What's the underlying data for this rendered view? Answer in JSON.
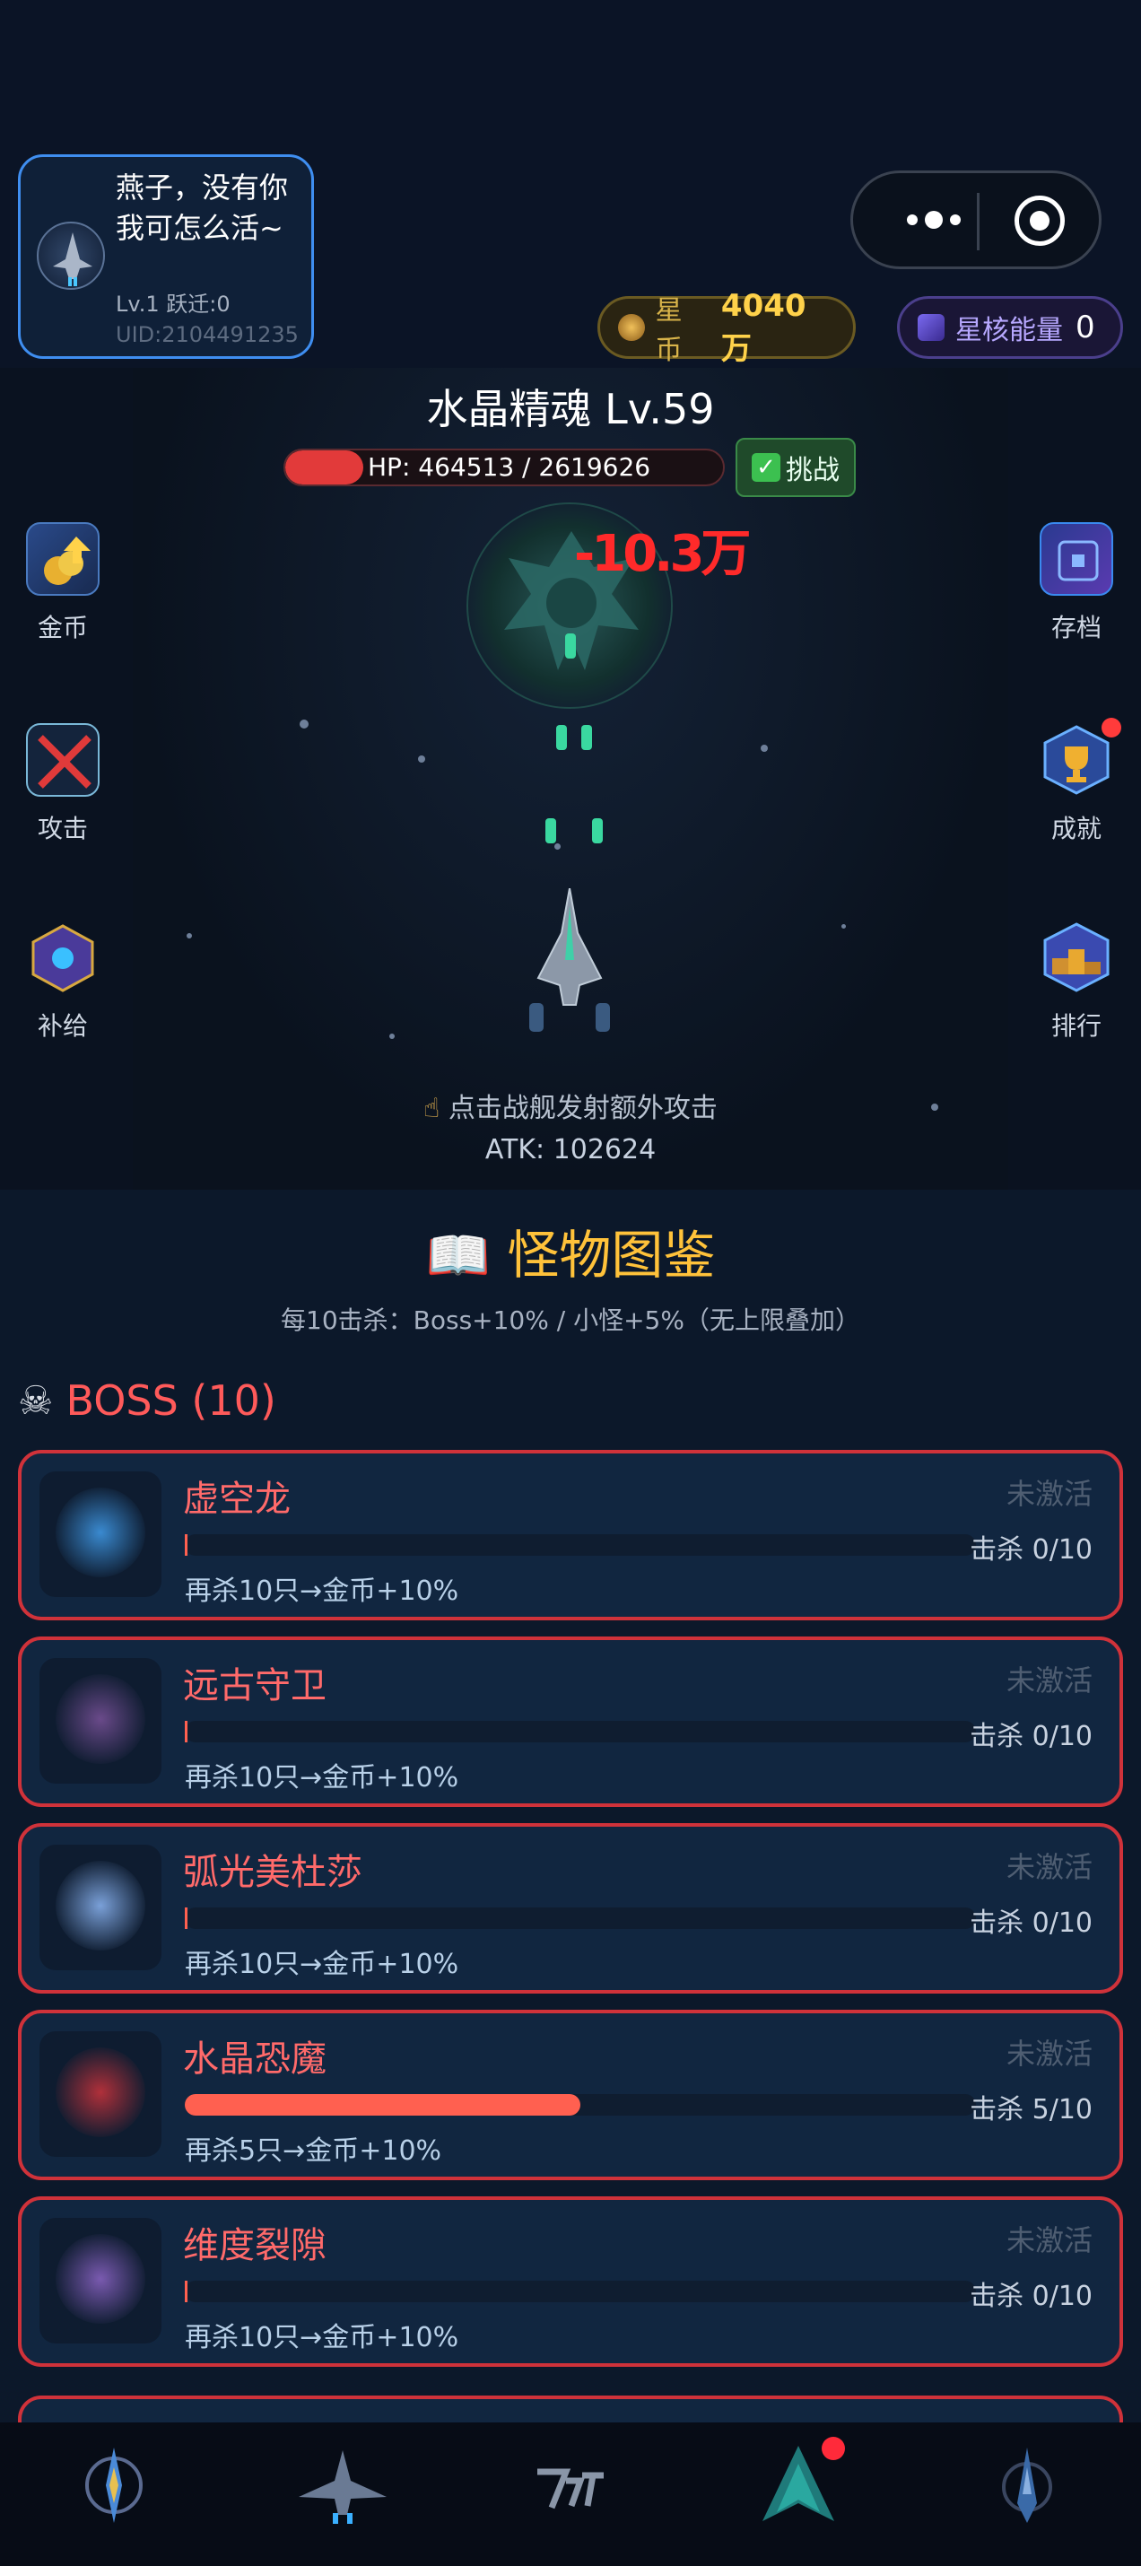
{
  "profile": {
    "nickname": "燕子，没有你我可怎么活~",
    "level_line": "Lv.1 跃迁:0",
    "uid": "UID:2104491235"
  },
  "currency": {
    "coin_label": "星币",
    "coin_value": "4040万",
    "core_label": "星核能量",
    "core_value": "0"
  },
  "battle": {
    "monster_title": "水晶精魂 Lv.59",
    "hp_text": "HP: 464513 / 2619626",
    "hp_current": 464513,
    "hp_max": 2619626,
    "challenge_label": "挑战",
    "damage_text": "-10.3万",
    "tap_hint": "点击战舰发射额外攻击",
    "atk_text": "ATK: 102624"
  },
  "left_menu": [
    {
      "label": "金币",
      "icon": "gold-coins-icon"
    },
    {
      "label": "攻击",
      "icon": "crossed-swords-icon"
    },
    {
      "label": "补给",
      "icon": "supply-crate-icon"
    }
  ],
  "right_menu": [
    {
      "label": "存档",
      "icon": "save-disk-icon",
      "has_badge": false
    },
    {
      "label": "成就",
      "icon": "trophy-icon",
      "has_badge": true
    },
    {
      "label": "排行",
      "icon": "podium-icon",
      "has_badge": false
    }
  ],
  "book": {
    "title": "怪物图鉴",
    "subtitle": "每10击杀：Boss+10% / 小怪+5%（无上限叠加）",
    "section_title": "BOSS (10)"
  },
  "bosses": [
    {
      "name": "虚空龙",
      "state": "未激活",
      "kills": "击杀 0/10",
      "progress": 0.0,
      "bonus": "再杀10只→金币+10%",
      "color": "#3a8ad0"
    },
    {
      "name": "远古守卫",
      "state": "未激活",
      "kills": "击杀 0/10",
      "progress": 0.0,
      "bonus": "再杀10只→金币+10%",
      "color": "#6a4a8a"
    },
    {
      "name": "弧光美杜莎",
      "state": "未激活",
      "kills": "击杀 0/10",
      "progress": 0.0,
      "bonus": "再杀10只→金币+10%",
      "color": "#7aa0d8"
    },
    {
      "name": "水晶恐魔",
      "state": "未激活",
      "kills": "击杀 5/10",
      "progress": 0.5,
      "bonus": "再杀5只→金币+10%",
      "color": "#b0303a"
    },
    {
      "name": "维度裂隙",
      "state": "未激活",
      "kills": "击杀 0/10",
      "progress": 0.0,
      "bonus": "再杀10只→金币+10%",
      "color": "#7a5ab0"
    }
  ],
  "nav": [
    {
      "icon": "emblem-icon",
      "badge": false
    },
    {
      "icon": "fighter-ship-icon",
      "badge": false
    },
    {
      "icon": "logo-glyph-icon",
      "badge": false
    },
    {
      "icon": "teal-arrow-ship-icon",
      "badge": true
    },
    {
      "icon": "blue-ship-icon",
      "badge": false
    }
  ]
}
